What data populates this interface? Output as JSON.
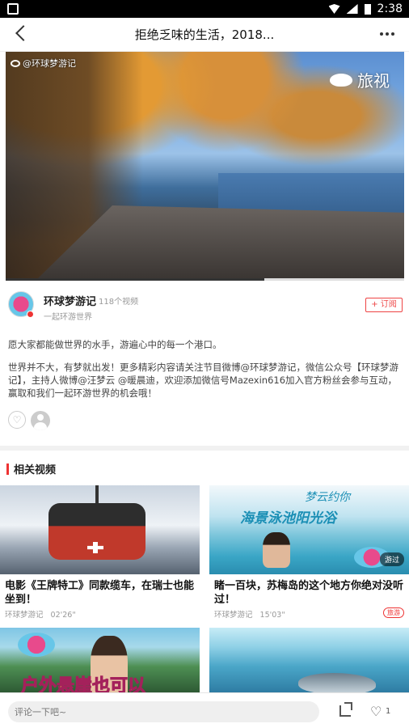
{
  "status_bar": {
    "time": "2:38"
  },
  "navbar": {
    "title": "拒绝乏味的生活，2018..."
  },
  "video": {
    "watermark_left": "@环球梦游记",
    "watermark_right": "旅视",
    "progress_fraction": 0.65
  },
  "channel": {
    "name": "环球梦游记",
    "video_count": "118个视频",
    "slogan": "一起环游世界",
    "subscribe_label": "+ 订阅"
  },
  "description": {
    "line1": "愿大家都能做世界的水手，游遍心中的每一个港口。",
    "line2": "世界并不大，有梦就出发！更多精彩内容请关注节目微博@环球梦游记，微信公众号【环球梦游记】，主持人微博@汪梦云 @暖晨迪，欢迎添加微信号Mazexin616加入官方粉丝会参与互动，赢取和我们一起环游世界的机会哦！"
  },
  "related": {
    "title": "相关视频",
    "items": [
      {
        "title": "电影《王牌特工》同款缆车，在瑞士也能坐到！",
        "source": "环球梦游记",
        "duration": "02'26\""
      },
      {
        "title": "睹一百块，苏梅岛的这个地方你绝对没听过！",
        "source": "环球梦游记",
        "duration": "15'03\"",
        "tag": "旅游",
        "thumb_text_top": "梦云约你",
        "thumb_text": "海景泳池阳光浴",
        "thumb_source": "游过"
      },
      {
        "thumb_text": "户外悬崖也可以"
      },
      {}
    ]
  },
  "bottom_bar": {
    "comment_placeholder": "评论一下吧~",
    "like_count": "1"
  },
  "colors": {
    "accent": "#e33333"
  }
}
